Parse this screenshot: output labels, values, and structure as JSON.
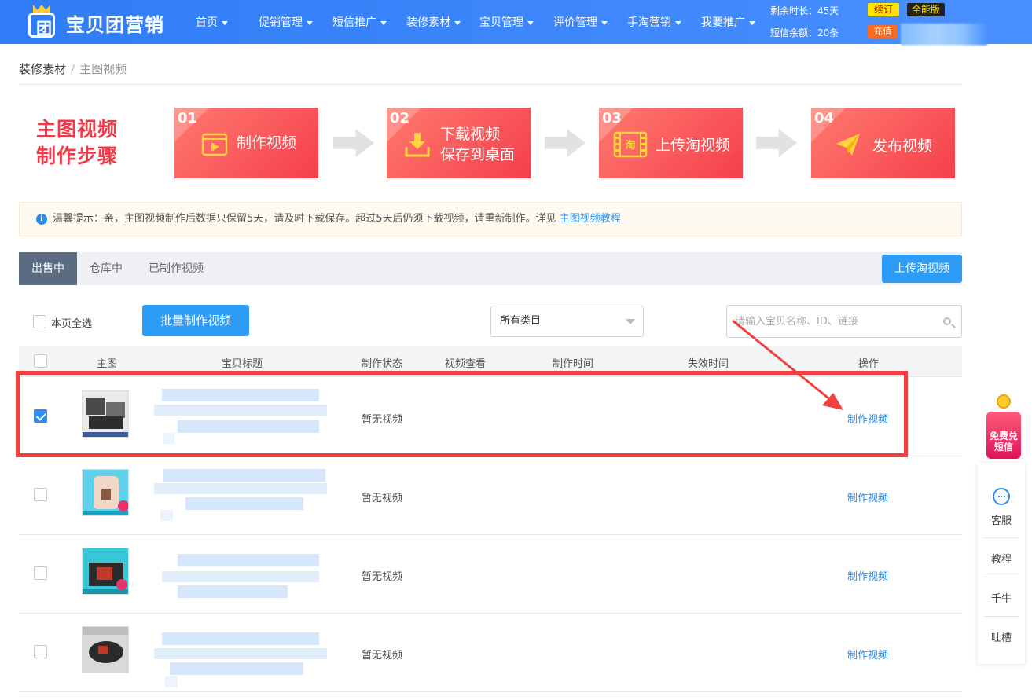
{
  "header": {
    "brand": "宝贝团营销",
    "logo_char": "团",
    "nav": [
      "首页",
      "促销管理",
      "短信推广",
      "装修素材",
      "宝贝管理",
      "评价管理",
      "手淘营销",
      "我要推广"
    ],
    "remaining_time": "剩余时长：45天",
    "sms_balance": "短信余额：20条",
    "renew": "续订",
    "edition": "全能版",
    "recharge": "充值"
  },
  "breadcrumb": {
    "parent": "装修素材",
    "separator": "/",
    "current": "主图视频"
  },
  "steps": {
    "title_line1": "主图视频",
    "title_line2": "制作步骤",
    "items": [
      {
        "num": "01",
        "line1": "制作视频",
        "line2": ""
      },
      {
        "num": "02",
        "line1": "下载视频",
        "line2": "保存到桌面"
      },
      {
        "num": "03",
        "line1": "上传淘视频",
        "line2": ""
      },
      {
        "num": "04",
        "line1": "发布视频",
        "line2": ""
      }
    ],
    "icons": [
      "play-video-icon",
      "download-icon",
      "film-taobao-icon",
      "paper-plane-icon"
    ],
    "taobao_char": "淘"
  },
  "tip": {
    "icon": "i",
    "text": "温馨提示：亲，主图视频制作后数据只保留5天，请及时下载保存。超过5天后仍须下载视频，请重新制作。详见 ",
    "link": "主图视频教程"
  },
  "tabs": {
    "items": [
      "出售中",
      "仓库中",
      "已制作视频"
    ],
    "active": 0,
    "upload_button": "上传淘视频"
  },
  "toolbar": {
    "select_all": "本页全选",
    "batch_button": "批量制作视频",
    "category_selected": "所有类目",
    "search_placeholder": "请输入宝贝名称、ID、链接"
  },
  "table": {
    "columns": [
      "主图",
      "宝贝标题",
      "制作状态",
      "视频查看",
      "制作时间",
      "失效时间",
      "操作"
    ],
    "rows": [
      {
        "checked": true,
        "status": "暂无视频",
        "action": "制作视频"
      },
      {
        "checked": false,
        "status": "暂无视频",
        "action": "制作视频"
      },
      {
        "checked": false,
        "status": "暂无视频",
        "action": "制作视频"
      },
      {
        "checked": false,
        "status": "暂无视频",
        "action": "制作视频"
      }
    ]
  },
  "sidebar": {
    "promo_line1": "免费兑",
    "promo_line2": "短信",
    "items": [
      "客服",
      "教程",
      "千牛",
      "吐槽"
    ]
  },
  "colors": {
    "brand_blue": "#2f7cf6",
    "step_red": "#f53f4c",
    "link_blue": "#2d8cf0",
    "highlight_red": "#f04040"
  }
}
